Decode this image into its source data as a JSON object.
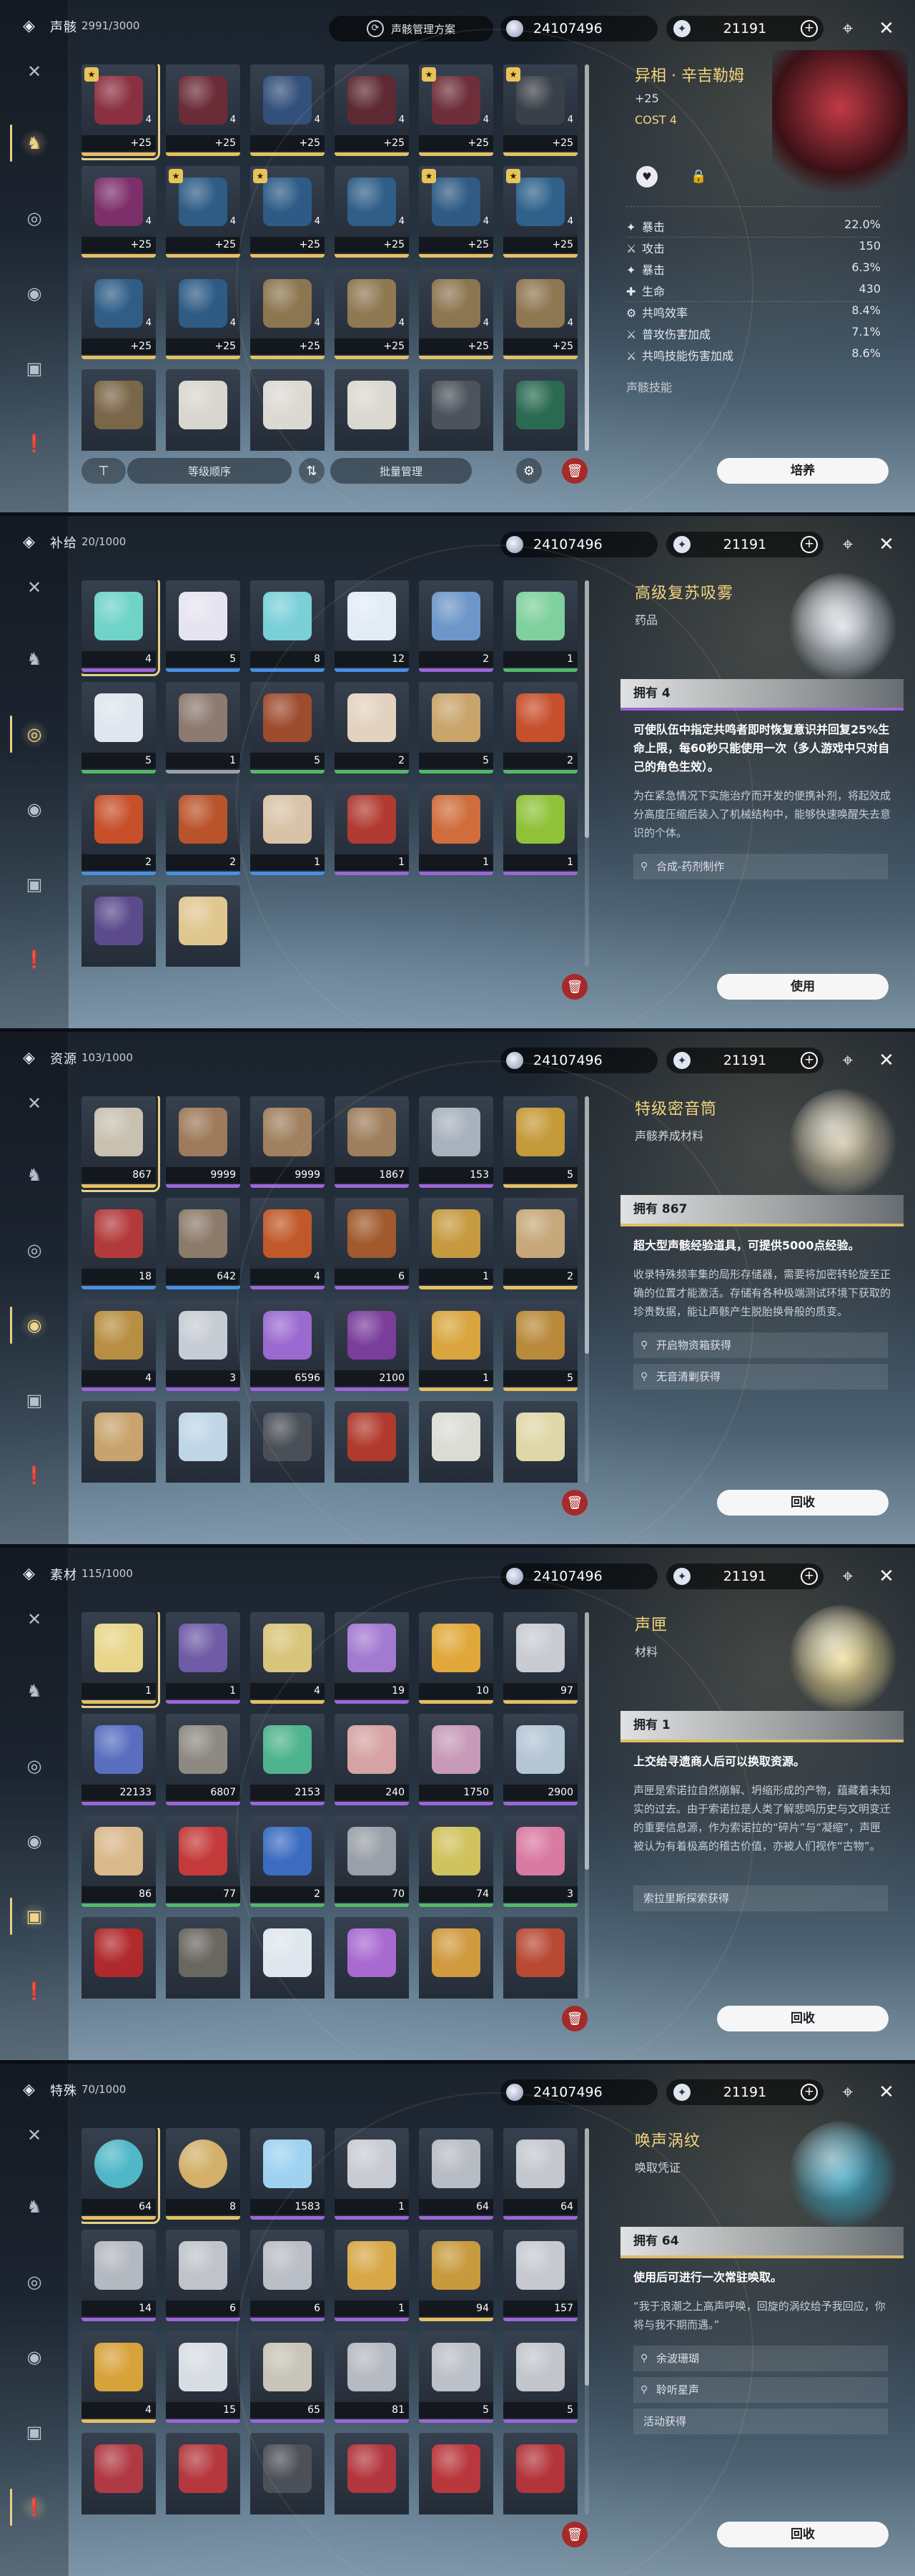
{
  "toolbar": {
    "preset_label": "声骸管理方案",
    "shell_credit": "24107496",
    "astrite": "21191"
  },
  "sidebar_icons": [
    "swords-icon",
    "echo-icon",
    "pill-icon",
    "resource-icon",
    "material-icon",
    "special-icon"
  ],
  "panels": [
    {
      "category": "声骸",
      "count": "2991/3000",
      "active_side": 1,
      "grid": [
        {
          "sel": true,
          "q": "q5",
          "color": "#8b3040",
          "lvl": "+25",
          "cost": "4",
          "badge": "★"
        },
        {
          "q": "q5",
          "color": "#6a2c36",
          "lvl": "+25",
          "cost": "4"
        },
        {
          "q": "q5",
          "color": "#33507a",
          "lvl": "+25",
          "cost": "4"
        },
        {
          "q": "q5",
          "color": "#5d2a33",
          "lvl": "+25",
          "cost": "4"
        },
        {
          "q": "q5",
          "color": "#6e2f3a",
          "lvl": "+25",
          "cost": "4",
          "badge": "★"
        },
        {
          "q": "q5",
          "color": "#3a3f48",
          "lvl": "+25",
          "cost": "4",
          "badge": "★"
        },
        {
          "q": "q5",
          "color": "#7c2f6a",
          "lvl": "+25",
          "cost": "4"
        },
        {
          "q": "q5",
          "color": "#2e5c84",
          "lvl": "+25",
          "cost": "4",
          "badge": "★"
        },
        {
          "q": "q5",
          "color": "#2d5b86",
          "lvl": "+25",
          "cost": "4",
          "badge": "★"
        },
        {
          "q": "q5",
          "color": "#2f5f89",
          "lvl": "+25",
          "cost": "4"
        },
        {
          "q": "q5",
          "color": "#2e5a84",
          "lvl": "+25",
          "cost": "4",
          "badge": "★"
        },
        {
          "q": "q5",
          "color": "#30618b",
          "lvl": "+25",
          "cost": "4",
          "badge": "★"
        },
        {
          "q": "q5",
          "color": "#2f5d86",
          "lvl": "+25",
          "cost": "4"
        },
        {
          "q": "q5",
          "color": "#2e5b84",
          "lvl": "+25",
          "cost": "4"
        },
        {
          "q": "q5",
          "color": "#8c7650",
          "lvl": "+25",
          "cost": "4"
        },
        {
          "q": "q5",
          "color": "#8f7852",
          "lvl": "+25",
          "cost": "4"
        },
        {
          "q": "q5",
          "color": "#8c7650",
          "lvl": "+25",
          "cost": "4"
        },
        {
          "q": "q5",
          "color": "#8e7751",
          "lvl": "+25",
          "cost": "4"
        },
        {
          "q": "q5",
          "color": "#7a6648",
          "lvl": "",
          "cost": ""
        },
        {
          "q": "q5",
          "color": "#d9d6cf",
          "lvl": "",
          "cost": ""
        },
        {
          "q": "q5",
          "color": "#dcd9d3",
          "lvl": "",
          "cost": ""
        },
        {
          "q": "q5",
          "color": "#dbd8d1",
          "lvl": "",
          "cost": ""
        },
        {
          "q": "q5",
          "color": "#4c535c",
          "lvl": "",
          "cost": ""
        },
        {
          "q": "q5",
          "color": "#2b6a52",
          "lvl": "",
          "cost": ""
        }
      ],
      "detail": {
        "name": "异相 · 辛吉勒姆",
        "level": "+25",
        "cost": "COST  4",
        "art": "#7a1f2a",
        "stats": [
          {
            "icon": "✦",
            "label": "暴击",
            "value": "22.0%"
          },
          {
            "icon": "⚔",
            "label": "攻击",
            "value": "150"
          },
          {
            "icon": "✦",
            "label": "暴击",
            "value": "6.3%"
          },
          {
            "icon": "✚",
            "label": "生命",
            "value": "430"
          },
          {
            "icon": "⚙",
            "label": "共鸣效率",
            "value": "8.4%"
          },
          {
            "icon": "⚔",
            "label": "普攻伤害加成",
            "value": "7.1%"
          },
          {
            "icon": "⚔",
            "label": "共鸣技能伤害加成",
            "value": "8.6%"
          }
        ],
        "skill_label": "声骸技能",
        "button": "培养"
      },
      "bottom": {
        "sort": "等级顺序",
        "batch": "批量管理"
      }
    },
    {
      "category": "补给",
      "count": "20/1000",
      "active_side": 2,
      "grid": [
        {
          "sel": true,
          "q": "q4",
          "color": "#6fd3c8",
          "qty": "4"
        },
        {
          "q": "q3",
          "color": "#e6e4f0",
          "qty": "5"
        },
        {
          "q": "q3",
          "color": "#7bd0d8",
          "qty": "8"
        },
        {
          "q": "q3",
          "color": "#e2ecf5",
          "qty": "12"
        },
        {
          "q": "q4",
          "color": "#6e97c9",
          "qty": "2"
        },
        {
          "q": "q2",
          "color": "#7fd09d",
          "qty": "1"
        },
        {
          "q": "q2",
          "color": "#dfe6ee",
          "qty": "5"
        },
        {
          "q": "q1",
          "color": "#8d7a70",
          "qty": "1"
        },
        {
          "q": "q2",
          "color": "#9d4c2e",
          "qty": "5"
        },
        {
          "q": "q2",
          "color": "#e3d2bf",
          "qty": "2"
        },
        {
          "q": "q2",
          "color": "#c9a46b",
          "qty": "5"
        },
        {
          "q": "q2",
          "color": "#c74f2c",
          "qty": "2"
        },
        {
          "q": "q3",
          "color": "#c7502b",
          "qty": "2"
        },
        {
          "q": "q3",
          "color": "#b9542a",
          "qty": "2"
        },
        {
          "q": "q3",
          "color": "#d8c3a8",
          "qty": "1"
        },
        {
          "q": "q4",
          "color": "#b13b32",
          "qty": "1"
        },
        {
          "q": "q4",
          "color": "#cf6d3c",
          "qty": "1"
        },
        {
          "q": "q4",
          "color": "#8fc238",
          "qty": "1"
        },
        {
          "q": "q4",
          "color": "#5b4a8c",
          "qty": ""
        },
        {
          "q": "q3",
          "color": "#e0c790",
          "qty": ""
        }
      ],
      "detail": {
        "name": "高级复苏吸雾",
        "sub": "药品",
        "art": "#d9dfe8",
        "owned": "拥有 4",
        "bar": "#9b63d8",
        "short": "可使队伍中指定共鸣者即时恢复意识并回复25%生命上限，每60秒只能使用一次（多人游戏中只对自己的角色生效）。",
        "long": "为在紧急情况下实施治疗而开发的便携补剂，将起效成分高度压缩后装入了机械结构中，能够快速唤醒失去意识的个体。",
        "sources": [
          {
            "icon": "⚲",
            "text": "合成-药剂制作"
          }
        ],
        "button": "使用"
      }
    },
    {
      "category": "资源",
      "count": "103/1000",
      "active_side": 3,
      "grid": [
        {
          "sel": true,
          "q": "q5",
          "color": "#c9c1b0",
          "qty": "867"
        },
        {
          "q": "q4",
          "color": "#9c7a5a",
          "qty": "9999"
        },
        {
          "q": "q4",
          "color": "#a0805e",
          "qty": "9999"
        },
        {
          "q": "q4",
          "color": "#9e7e5c",
          "qty": "1867"
        },
        {
          "q": "q4",
          "color": "#a8b2bd",
          "qty": "153"
        },
        {
          "q": "q5",
          "color": "#c49a3a",
          "qty": "5"
        },
        {
          "q": "q3",
          "color": "#b33a3a",
          "qty": "18"
        },
        {
          "q": "q3",
          "color": "#8c7b6a",
          "qty": "642"
        },
        {
          "q": "q4",
          "color": "#c0592a",
          "qty": "4"
        },
        {
          "q": "q4",
          "color": "#a05a2c",
          "qty": "6"
        },
        {
          "q": "q5",
          "color": "#c69a40",
          "qty": "1"
        },
        {
          "q": "q5",
          "color": "#c7a87a",
          "qty": "2"
        },
        {
          "q": "q4",
          "color": "#b88f42",
          "qty": "4"
        },
        {
          "q": "q4",
          "color": "#c7ccd4",
          "qty": "3"
        },
        {
          "q": "q4",
          "color": "#9a6ad0",
          "qty": "6596"
        },
        {
          "q": "q4",
          "color": "#7a3e9a",
          "qty": "2100"
        },
        {
          "q": "q5",
          "color": "#d9a53e",
          "qty": "1"
        },
        {
          "q": "q5",
          "color": "#b88a3a",
          "qty": "5"
        },
        {
          "q": "q4",
          "color": "#c8a36e",
          "qty": ""
        },
        {
          "q": "q4",
          "color": "#bfd6e6",
          "qty": ""
        },
        {
          "q": "q4",
          "color": "#4a4f58",
          "qty": ""
        },
        {
          "q": "q4",
          "color": "#b13a2e",
          "qty": ""
        },
        {
          "q": "q5",
          "color": "#dcdcd6",
          "qty": ""
        },
        {
          "q": "q5",
          "color": "#e0d7a8",
          "qty": ""
        }
      ],
      "detail": {
        "name": "特级密音筒",
        "sub": "声骸养成材料",
        "art": "#cfc1a0",
        "owned": "拥有 867",
        "bar": "#e0be66",
        "short": "超大型声骸经验道具，可提供5000点经验。",
        "long": "收录特殊频率集的局形存储器，需要将加密转轮旋至正确的位置才能激活。存储有各种极端测试环境下获取的珍贵数据，能让声骸产生脱胎换骨般的质变。",
        "sources": [
          {
            "icon": "⚲",
            "text": "开启物资箱获得"
          },
          {
            "icon": "⚲",
            "text": "无音清剿获得"
          }
        ],
        "button": "回收"
      }
    },
    {
      "category": "素材",
      "count": "115/1000",
      "active_side": 4,
      "grid": [
        {
          "sel": true,
          "q": "q5",
          "color": "#e8d58a",
          "qty": "1"
        },
        {
          "q": "q4",
          "color": "#6f5ca6",
          "qty": "1"
        },
        {
          "q": "q5",
          "color": "#d8c47a",
          "qty": "4"
        },
        {
          "q": "q4",
          "color": "#a27ad0",
          "qty": "19"
        },
        {
          "q": "q5",
          "color": "#e0a83a",
          "qty": "10"
        },
        {
          "q": "q5",
          "color": "#c8ccd2",
          "qty": "97"
        },
        {
          "q": "q4",
          "color": "#5a6ec0",
          "qty": "22133"
        },
        {
          "q": "q4",
          "color": "#8e8a82",
          "qty": "6807"
        },
        {
          "q": "q4",
          "color": "#4fb48d",
          "qty": "2153"
        },
        {
          "q": "q4",
          "color": "#d5a3a3",
          "qty": "240"
        },
        {
          "q": "q4",
          "color": "#c79ab8",
          "qty": "1750"
        },
        {
          "q": "q4",
          "color": "#b4c5d6",
          "qty": "2900"
        },
        {
          "q": "q2",
          "color": "#d9b88a",
          "qty": "86"
        },
        {
          "q": "q2",
          "color": "#c43a3a",
          "qty": "77"
        },
        {
          "q": "q2",
          "color": "#3c6cc0",
          "qty": "2"
        },
        {
          "q": "q2",
          "color": "#9aa0a8",
          "qty": "70"
        },
        {
          "q": "q2",
          "color": "#d0c25c",
          "qty": "74"
        },
        {
          "q": "q2",
          "color": "#d97aa2",
          "qty": "3"
        },
        {
          "q": "q2",
          "color": "#b0292c",
          "qty": ""
        },
        {
          "q": "q2",
          "color": "#6a6660",
          "qty": ""
        },
        {
          "q": "q2",
          "color": "#dfe6ee",
          "qty": ""
        },
        {
          "q": "q2",
          "color": "#a86ad0",
          "qty": ""
        },
        {
          "q": "q2",
          "color": "#d09a3e",
          "qty": ""
        },
        {
          "q": "q2",
          "color": "#b84a34",
          "qty": ""
        }
      ],
      "detail": {
        "name": "声匣",
        "sub": "材料",
        "art": "#f0dd92",
        "owned": "拥有 1",
        "bar": "#e0be66",
        "short": "上交给寻遗商人后可以换取资源。",
        "long": "声匣是索诺拉自然崩解、坍缩形成的产物，蕴藏着未知实的过去。由于索诺拉是人类了解悲鸣历史与文明变迁的重要信息源，作为索诺拉的“碎片”与“凝缩”，声匣被认为有着极高的稽古价值，亦被人们视作“古物”。",
        "sources": [
          {
            "icon": "",
            "text": "索拉里斯探索获得",
            "plain": true
          }
        ],
        "button": "回收"
      }
    },
    {
      "category": "特殊",
      "count": "70/1000",
      "active_side": 5,
      "grid": [
        {
          "sel": true,
          "q": "q5",
          "color": "#4fb7c8",
          "qty": "64",
          "orb": true
        },
        {
          "q": "q5",
          "color": "#d2b06a",
          "qty": "8",
          "orb": true
        },
        {
          "q": "q4",
          "color": "#9fd2f0",
          "qty": "1583"
        },
        {
          "q": "q4",
          "color": "#c8ccd2",
          "qty": "1"
        },
        {
          "q": "q4",
          "color": "#b8bcc4",
          "qty": "64"
        },
        {
          "q": "q4",
          "color": "#c4c8ce",
          "qty": "64"
        },
        {
          "q": "q4",
          "color": "#b4b8c0",
          "qty": "14"
        },
        {
          "q": "q4",
          "color": "#c0c4ca",
          "qty": "6"
        },
        {
          "q": "q4",
          "color": "#babec6",
          "qty": "6"
        },
        {
          "q": "q4",
          "color": "#d8a848",
          "qty": "1"
        },
        {
          "q": "q5",
          "color": "#c89a3e",
          "qty": "94"
        },
        {
          "q": "q4",
          "color": "#c6cad0",
          "qty": "157"
        },
        {
          "q": "q5",
          "color": "#d8a23a",
          "qty": "4"
        },
        {
          "q": "q4",
          "color": "#d8dde4",
          "qty": "15"
        },
        {
          "q": "q4",
          "color": "#c8c4b8",
          "qty": "65"
        },
        {
          "q": "q4",
          "color": "#b6bac2",
          "qty": "81"
        },
        {
          "q": "q4",
          "color": "#bcc0c8",
          "qty": "5"
        },
        {
          "q": "q4",
          "color": "#c2c6cc",
          "qty": "5"
        },
        {
          "q": "q4",
          "color": "#b03a44",
          "qty": ""
        },
        {
          "q": "q4",
          "color": "#b4383e",
          "qty": ""
        },
        {
          "q": "q4",
          "color": "#4c5058",
          "qty": ""
        },
        {
          "q": "q4",
          "color": "#b2363e",
          "qty": ""
        },
        {
          "q": "q4",
          "color": "#b8383e",
          "qty": ""
        },
        {
          "q": "q4",
          "color": "#b3353c",
          "qty": ""
        }
      ],
      "detail": {
        "name": "唤声涡纹",
        "sub": "唤取凭证",
        "art": "#3aa6c2",
        "owned": "拥有 64",
        "bar": "#e0be66",
        "short": "使用后可进行一次常驻唤取。",
        "long": "“我于浪潮之上高声呼唤，回旋的涡纹给予我回应，你将与我不期而遇。”",
        "sources": [
          {
            "icon": "⚲",
            "text": "余波珊瑚"
          },
          {
            "icon": "⚲",
            "text": "聆听星声"
          },
          {
            "icon": "",
            "text": "活动获得",
            "plain": true
          }
        ],
        "button": "回收"
      }
    }
  ]
}
